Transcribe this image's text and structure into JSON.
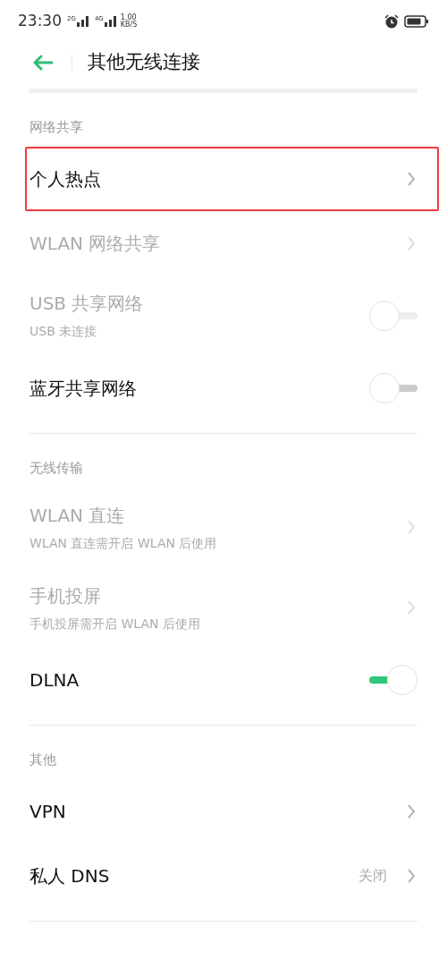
{
  "status_bar": {
    "time": "23:30",
    "sim1": "2G",
    "sim2": "4G",
    "speed_value": "1.00",
    "speed_unit": "KB/S"
  },
  "header": {
    "title": "其他无线连接"
  },
  "sections": [
    {
      "title": "网络共享",
      "items": [
        {
          "kind": "chevron",
          "label": "个人热点",
          "disabled": false,
          "highlighted": true
        },
        {
          "kind": "chevron",
          "label": "WLAN 网络共享",
          "disabled": true,
          "highlighted": false
        },
        {
          "kind": "switch",
          "label": "USB 共享网络",
          "subtitle": "USB 未连接",
          "disabled": true,
          "on": false,
          "highlighted": false
        },
        {
          "kind": "switch",
          "label": "蓝牙共享网络",
          "disabled": false,
          "on": false,
          "highlighted": false
        }
      ]
    },
    {
      "title": "无线传输",
      "items": [
        {
          "kind": "chevron",
          "label": "WLAN 直连",
          "subtitle": "WLAN 直连需开启 WLAN 后使用",
          "disabled": true,
          "highlighted": false
        },
        {
          "kind": "chevron",
          "label": "手机投屏",
          "subtitle": "手机投屏需开启 WLAN 后使用",
          "disabled": true,
          "highlighted": false
        },
        {
          "kind": "switch",
          "label": "DLNA",
          "disabled": false,
          "on": true,
          "highlighted": false
        }
      ]
    },
    {
      "title": "其他",
      "items": [
        {
          "kind": "chevron",
          "label": "VPN",
          "disabled": false,
          "highlighted": false
        },
        {
          "kind": "chevron",
          "label": "私人 DNS",
          "value": "关闭",
          "disabled": false,
          "highlighted": false
        }
      ]
    }
  ]
}
